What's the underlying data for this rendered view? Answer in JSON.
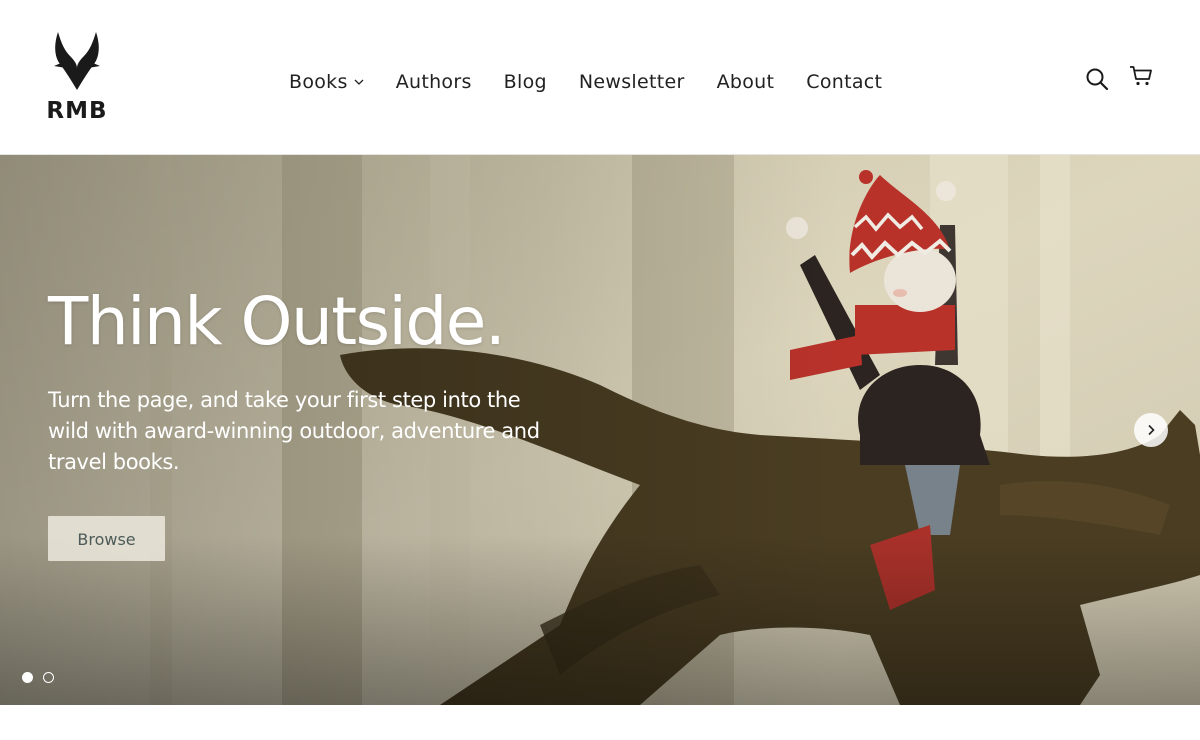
{
  "brand": {
    "name": "RMB",
    "logo_icon": "antelope-horns-icon"
  },
  "nav": {
    "items": [
      {
        "label": "Books",
        "has_dropdown": true
      },
      {
        "label": "Authors"
      },
      {
        "label": "Blog"
      },
      {
        "label": "Newsletter"
      },
      {
        "label": "About"
      },
      {
        "label": "Contact"
      }
    ]
  },
  "header_icons": [
    "search-icon",
    "cart-icon"
  ],
  "hero": {
    "title": "Think Outside.",
    "subtitle": "Turn the page, and take your first step into the wild with award-winning outdoor, adventure and travel books.",
    "button_label": "Browse",
    "slides_total": 2,
    "active_slide": 1
  },
  "colors": {
    "text": "#222222",
    "hero_text": "#ffffff",
    "button_bg": "#e8e4d8",
    "button_text": "#4d5a58",
    "wolf": "#4a3d22",
    "hat_red": "#b8322a"
  }
}
